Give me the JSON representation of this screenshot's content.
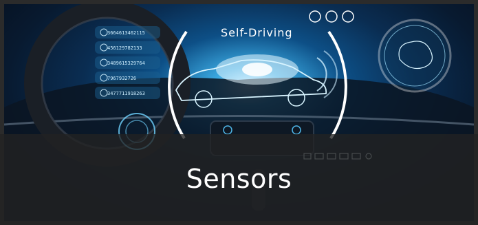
{
  "image": {
    "hud_title": "Self-Driving",
    "readouts": [
      "3664613462115",
      "456129782133",
      "3489615329764",
      "7967932726",
      "3477711918263"
    ]
  },
  "caption": {
    "text": "Sensors"
  },
  "colors": {
    "frame": "#2b2b2b",
    "hud_cyan": "#6fd3ff",
    "caption_text": "#ffffff"
  }
}
